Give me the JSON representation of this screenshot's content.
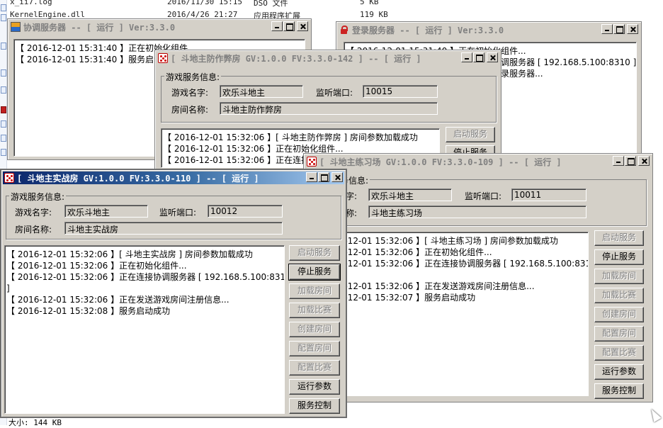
{
  "background": {
    "files": [
      {
        "name": "x_ii7.log",
        "date": "2016/11/30 15:15",
        "type": "DSO 文件",
        "size": "5 KB"
      },
      {
        "name": "KernelEngine.dll",
        "date": "2016/4/26 21:27",
        "type": "应用程序扩展",
        "size": "119 KB"
      }
    ],
    "status_size": "大小: 144 KB"
  },
  "coord_server": {
    "title": "协调服务器 -- [ 运行 ] Ver:3.3.0",
    "log": [
      "【 2016-12-01 15:31:40 】正在初始化组件...",
      "【 2016-12-01 15:31:40 】服务启动成功"
    ]
  },
  "login_server": {
    "title": "登录服务器 -- [ 运行 ] Ver:3.3.0",
    "log": [
      "【 2016-12-01 15:31:40 】正在初始化组件...",
      "【 2016-12-01 15:31:40 】正在连接协调服务器 [ 192.168.5.100:8310 ]",
      "【 2016-12-01 15:31:40 】正在启动登录服务器..."
    ]
  },
  "anticheat_room": {
    "title": "[ 斗地主防作弊房 GV:1.0.0 FV:3.3.0-142 ] -- [ 运行 ]",
    "group_title": "游戏服务信息:",
    "game_name_label": "游戏名字:",
    "game_name": "欢乐斗地主",
    "port_label": "监听端口:",
    "port": "10015",
    "room_label": "房间名称:",
    "room_name": "斗地主防作弊房",
    "log": [
      "【 2016-12-01 15:32:06 】[ 斗地主防作弊房 ] 房间参数加载成功",
      "【 2016-12-01 15:32:06 】正在初始化组件...",
      "【 2016-12-01 15:32:06 】正在连接协调服务器 [ 192.168.5.100:8310"
    ],
    "btn_start": "启动服务",
    "btn_stop": "停止服务"
  },
  "practice_room": {
    "title": "[ 斗地主练习场 GV:1.0.0 FV:3.3.0-109 ] -- [ 运行 ]",
    "group_title": "游戏服务信息:",
    "game_name_label": "游戏名字:",
    "game_name": "欢乐斗地主",
    "port_label": "监听端口:",
    "port": "10011",
    "room_label": "房间名称:",
    "room_name": "斗地主练习场",
    "log": [
      "【 2016-12-01 15:32:06 】[ 斗地主练习场 ] 房间参数加载成功",
      "【 2016-12-01 15:32:06 】正在初始化组件...",
      "【 2016-12-01 15:32:06 】正在连接协调服务器 [ 192.168.5.100:8310",
      "",
      "【 2016-12-01 15:32:06 】正在发送游戏房间注册信息...",
      "【 2016-12-01 15:32:07 】服务启动成功"
    ],
    "buttons": [
      "启动服务",
      "停止服务",
      "加载房间",
      "加载比赛",
      "创建房间",
      "配置房间",
      "配置比赛",
      "运行参数",
      "服务控制"
    ]
  },
  "battle_room": {
    "title": "[ 斗地主实战房 GV:1.0.0 FV:3.3.0-110 ] -- [ 运行 ]",
    "group_title": "游戏服务信息:",
    "game_name_label": "游戏名字:",
    "game_name": "欢乐斗地主",
    "port_label": "监听端口:",
    "port": "10012",
    "room_label": "房间名称:",
    "room_name": "斗地主实战房",
    "log": [
      "【 2016-12-01 15:32:06 】[ 斗地主实战房 ] 房间参数加载成功",
      "【 2016-12-01 15:32:06 】正在初始化组件...",
      "【 2016-12-01 15:32:06 】正在连接协调服务器 [ 192.168.5.100:8310",
      "]",
      "【 2016-12-01 15:32:06 】正在发送游戏房间注册信息...",
      "【 2016-12-01 15:32:08 】服务启动成功"
    ],
    "buttons": [
      "启动服务",
      "停止服务",
      "加载房间",
      "加载比赛",
      "创建房间",
      "配置房间",
      "配置比赛",
      "运行参数",
      "服务控制"
    ]
  }
}
